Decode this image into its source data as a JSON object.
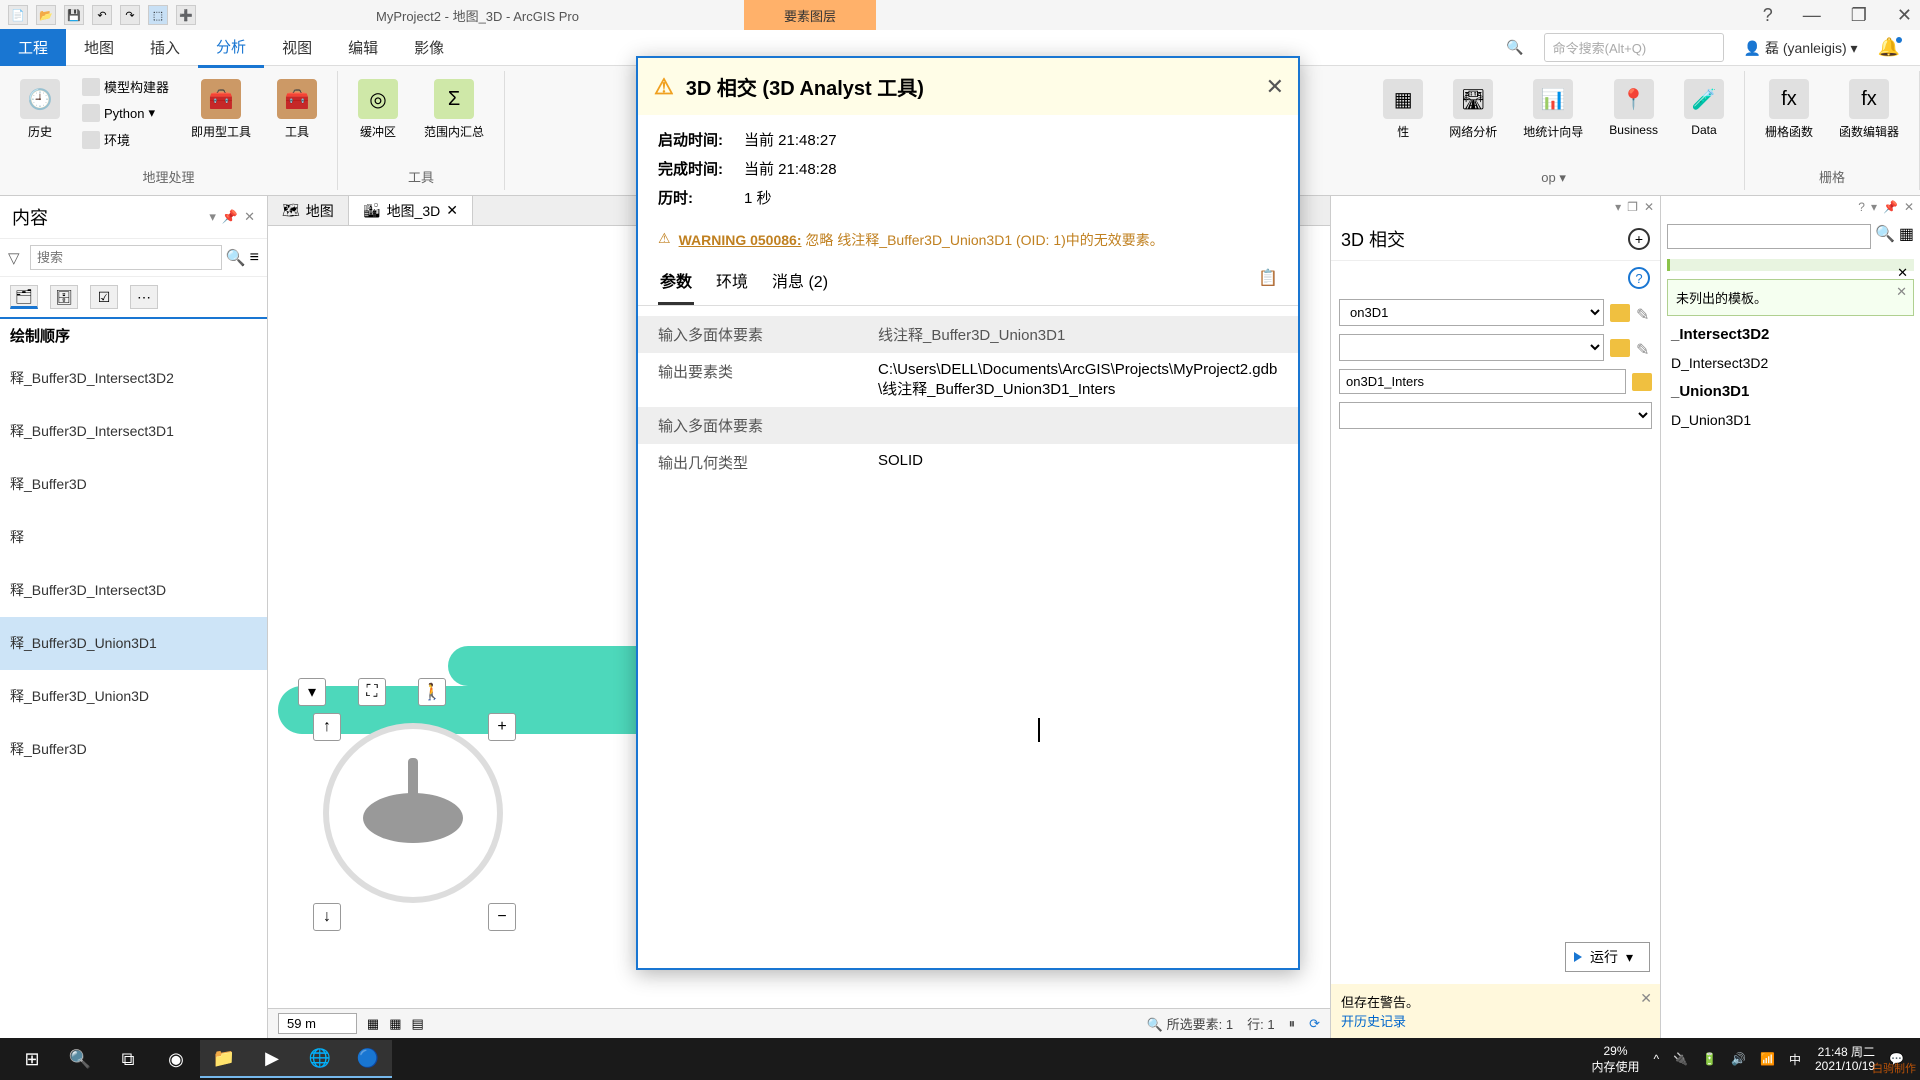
{
  "titlebar": {
    "title": "MyProject2 - 地图_3D - ArcGIS Pro",
    "context_tab": "要素图层"
  },
  "win_controls": {
    "help": "?",
    "min": "—",
    "max": "❐",
    "close": "✕"
  },
  "ribbon": {
    "tabs": {
      "file": "工程",
      "map": "地图",
      "insert": "插入",
      "analysis": "分析",
      "view": "视图",
      "edit": "编辑",
      "imagery": "影像"
    },
    "search_placeholder": "命令搜索(Alt+Q)",
    "user": "磊 (yanleigis)",
    "groups": {
      "geoprocessing": {
        "label": "地理处理",
        "history": "历史",
        "modelbuilder": "模型构建器",
        "python": "Python",
        "env": "环境",
        "ready_tools": "即用型工具",
        "tools": "工具"
      },
      "tools_group": {
        "label": "工具",
        "buffer": "缓冲区",
        "summarize": "范围内汇总"
      },
      "network": {
        "label": "网络分析",
        "geostat": "地统计向导",
        "business": "Business",
        "data": "Data"
      },
      "raster": {
        "label": "栅格",
        "raster_func": "栅格函数",
        "func_editor": "函数编辑器"
      }
    }
  },
  "contents": {
    "title": "内容",
    "search_placeholder": "搜索",
    "draw_order": "绘制顺序",
    "items": [
      "释_Buffer3D_Intersect3D2",
      "释_Buffer3D_Intersect3D1",
      "释_Buffer3D",
      "释",
      "释_Buffer3D_Intersect3D",
      "释_Buffer3D_Union3D1",
      "释_Buffer3D_Union3D",
      "释_Buffer3D"
    ],
    "selected_index": 5
  },
  "map": {
    "tabs": [
      {
        "label": "地图"
      },
      {
        "label": "地图_3D"
      }
    ],
    "scale": "59 m",
    "status": {
      "selected": "所选要素: 1",
      "row": "行: 1"
    }
  },
  "gp_panel": {
    "title": "3D 相交",
    "input1": "on3D1",
    "output": "on3D1_Inters",
    "run_label": "运行",
    "warn_complete": "但存在警告。",
    "warn_history": "开历史记录"
  },
  "create_panel": {
    "warn": "未列出的模板。",
    "templates": [
      {
        "bold": "_Intersect3D2"
      },
      {
        "plain": "D_Intersect3D2"
      },
      {
        "bold": "_Union3D1"
      },
      {
        "plain": "D_Union3D1"
      }
    ]
  },
  "popup": {
    "title": "3D 相交 (3D Analyst 工具)",
    "info": {
      "start_k": "启动时间:",
      "start_v": "当前 21:48:27",
      "end_k": "完成时间:",
      "end_v": "当前 21:48:28",
      "elapsed_k": "历时:",
      "elapsed_v": "1 秒"
    },
    "warning_code": "WARNING 050086:",
    "warning_msg": "忽略 线注释_Buffer3D_Union3D1 (OID: 1)中的无效要素。",
    "tabs": {
      "params": "参数",
      "env": "环境",
      "messages": "消息 (2)"
    },
    "params": [
      {
        "hdr": true,
        "k": "输入多面体要素",
        "v": "线注释_Buffer3D_Union3D1"
      },
      {
        "hdr": false,
        "k": "输出要素类",
        "v": "C:\\Users\\DELL\\Documents\\ArcGIS\\Projects\\MyProject2.gdb\\线注释_Buffer3D_Union3D1_Inters"
      },
      {
        "hdr": true,
        "k": "输入多面体要素",
        "v": ""
      },
      {
        "hdr": false,
        "k": "输出几何类型",
        "v": "SOLID"
      }
    ]
  },
  "taskbar": {
    "battery": "29%",
    "mem": "内存使用",
    "ime": "中",
    "time": "21:48 周二",
    "date": "2021/10/19",
    "watermark": "白驹制作"
  }
}
